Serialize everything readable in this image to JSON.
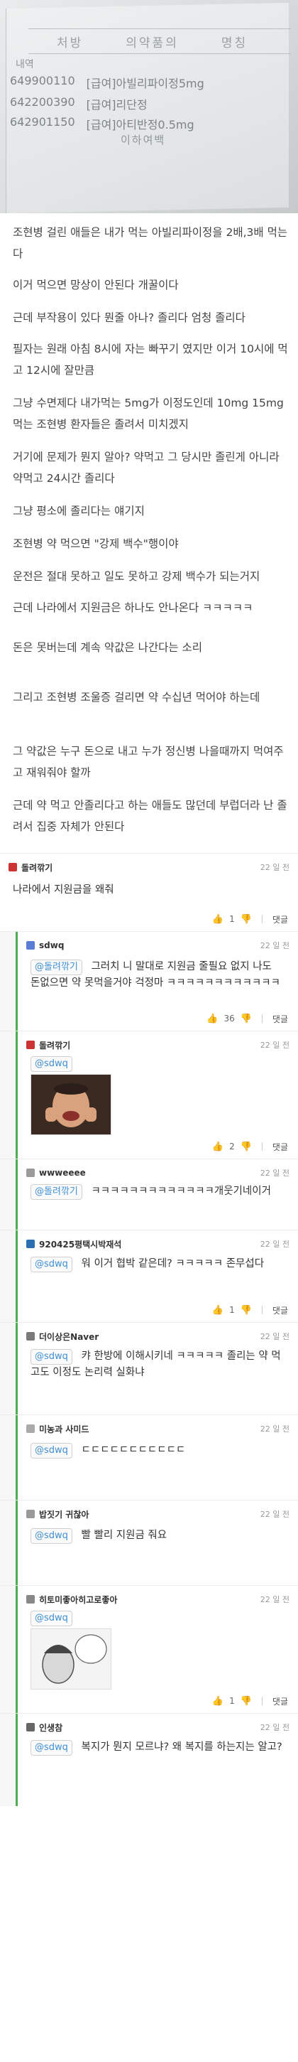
{
  "photo": {
    "header": [
      "처방",
      "의약품의",
      "명칭"
    ],
    "label": "내역",
    "rows": [
      {
        "code": "649900110",
        "name": "[급여]아빌리파이정5mg"
      },
      {
        "code": "642200390",
        "name": "[급여]리단정"
      },
      {
        "code": "642901150",
        "name": "[급여]아티반정0.5mg"
      }
    ],
    "end": "이하여백"
  },
  "post": {
    "paragraphs": [
      "조현병 걸린 애들은 내가 먹는 아빌리파이정을 2배,3배 먹는다",
      "이거 먹으면 망상이 안된다 개꿀이다",
      "근데 부작용이 있다 뭔줄 아나? 졸리다 엄청 졸리다",
      "필자는 원래 아침 8시에 자는 빠꾸기 였지만 이거 10시에 먹고 12시에 잘만큼",
      "그냥 수면제다 내가먹는 5mg가 이정도인데 10mg 15mg 먹는 조현병 환자들은 졸려서 미치겠지",
      "거기에 문제가 뭔지 알아? 약먹고 그 당시만 졸린게 아니라 약먹고 24시간 졸리다",
      "그냥 평소에 졸리다는 얘기지",
      "조현병 약 먹으면 \"강제 백수\"행이야",
      "운전은 절대 못하고 일도 못하고 강제 백수가 되는거지",
      "근데 나라에서 지원금은 하나도 안나온다 ㅋㅋㅋㅋㅋ",
      "돈은 못버는데 계속 약값은 나간다는 소리",
      "그리고 조현병 조울증 걸리면 약 수십년 먹어야 하는데",
      "그 약값은 누구 돈으로 내고 누가 정신병 나을때까지 먹여주고 재워줘야 할까",
      "근데 약 먹고 안졸리다고 하는 애들도 많던데 부럽더라 난 졸려서 집중 자체가 안된다"
    ]
  },
  "comments": [
    {
      "nick": "돌려깎기",
      "time": "22 일 전",
      "mention": "",
      "text": "나라에서 지원금을 왜줘",
      "likes": "1",
      "reply_label": "댓글",
      "reply": false
    },
    {
      "nick": "sdwq",
      "time": "22 일 전",
      "mention": "@돌려깎기",
      "text": "그러치 니 말대로 지원금 줄필요 없지 나도 돈없으면 약 못먹을거야 걱정마 ㅋㅋㅋㅋㅋㅋㅋㅋㅋㅋㅋㅋ",
      "likes": "36",
      "reply_label": "댓글",
      "reply": true
    },
    {
      "nick": "돌려깎기",
      "time": "22 일 전",
      "mention": "@sdwq",
      "text": "",
      "likes": "2",
      "reply_label": "댓글",
      "reply": true
    },
    {
      "nick": "wwweeee",
      "time": "22 일 전",
      "mention": "@돌려깎기",
      "text": "ㅋㅋㅋㅋㅋㅋㅋㅋㅋㅋㅋㅋㅋ개웃기네이거",
      "likes": "",
      "reply_label": "",
      "reply": true
    },
    {
      "nick": "920425평택시박재석",
      "time": "22 일 전",
      "mention": "@sdwq",
      "text": "워 이거 협박 같은데? ㅋㅋㅋㅋㅋ 존무섭다",
      "likes": "1",
      "reply_label": "댓글",
      "reply": true
    },
    {
      "nick": "더이상은Naver",
      "time": "22 일 전",
      "mention": "@sdwq",
      "text": "캬 한방에 이해시키네 ㅋㅋㅋㅋㅋ 졸리는 약 먹고도 이정도 논리력 실화냐",
      "likes": "",
      "reply_label": "",
      "reply": true
    },
    {
      "nick": "미농과 사미드",
      "time": "22 일 전",
      "mention": "@sdwq",
      "text": "ㄷㄷㄷㄷㄷㄷㄷㄷㄷㄷㄷ",
      "likes": "",
      "reply_label": "",
      "reply": true
    },
    {
      "nick": "밥짓기 귀찮아",
      "time": "22 일 전",
      "mention": "@sdwq",
      "text": "빨 빨리 지원금 줘요",
      "likes": "",
      "reply_label": "",
      "reply": true
    },
    {
      "nick": "히토미좋아히고로좋아",
      "time": "22 일 전",
      "mention": "@sdwq",
      "text": "",
      "likes": "1",
      "reply_label": "댓글",
      "reply": true
    },
    {
      "nick": "인생참",
      "time": "22 일 전",
      "mention": "@sdwq",
      "text": "복지가 뭔지 모르냐? 왜 복지를 하는지는 알고?",
      "likes": "",
      "reply_label": "",
      "reply": true
    }
  ],
  "colors": {
    "accent": "#4cae4c",
    "mention": "#3f8fd4"
  }
}
